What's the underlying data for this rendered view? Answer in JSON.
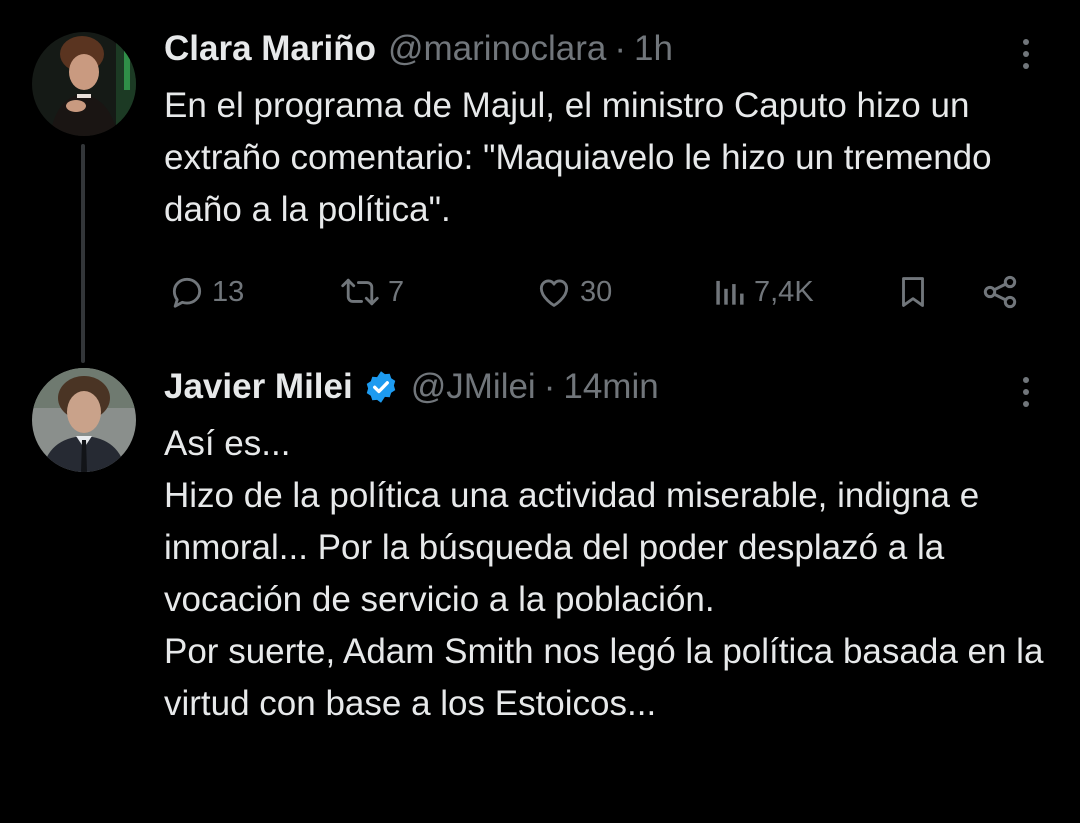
{
  "tweets": [
    {
      "author_name": "Clara Mariño",
      "handle": "@marinoclara",
      "separator": "·",
      "time": "1h",
      "verified": false,
      "text_lines": [
        "En el programa de Majul, el ministro Caputo hizo un extraño comentario: \"Maquiavelo le hizo un tremendo daño a la política\"."
      ],
      "stats": {
        "replies": "13",
        "retweets": "7",
        "likes": "30",
        "views": "7,4K"
      },
      "icons": {
        "avatar": "avatar-photo",
        "more": "more-vertical-icon",
        "reply": "comment-icon",
        "retweet": "retweet-icon",
        "like": "heart-icon",
        "views": "views-chart-icon",
        "bookmark": "bookmark-icon",
        "share": "share-icon"
      }
    },
    {
      "author_name": "Javier Milei",
      "handle": "@JMilei",
      "separator": "·",
      "time": "14min",
      "verified": true,
      "text_lines": [
        "Así es...",
        "Hizo de la política una actividad miserable, indigna e inmoral... Por la búsqueda del poder desplazó a la vocación de servicio a la población.",
        "Por suerte, Adam Smith nos legó la política basada en la virtud con base a los Estoicos..."
      ],
      "icons": {
        "avatar": "avatar-photo",
        "verified": "verified-badge-icon",
        "more": "more-vertical-icon"
      }
    }
  ],
  "colors": {
    "background": "#000000",
    "text_primary": "#e7e9ea",
    "text_secondary": "#71767b",
    "thread_line": "#333639",
    "verified_badge": "#1d9bf0"
  }
}
